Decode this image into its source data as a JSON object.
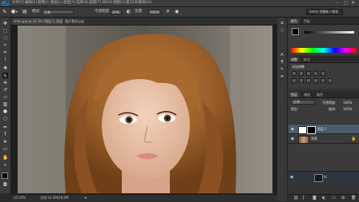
{
  "app": {
    "logo": "Ps"
  },
  "menu": [
    "文件(F)",
    "编辑(E)",
    "图像(I)",
    "图层(L)",
    "类型(Y)",
    "选择(S)",
    "滤镜(T)",
    "3D(D)",
    "视图(V)",
    "窗口(W)",
    "帮助(H)"
  ],
  "options_bar": {
    "mode_label": "模式:",
    "mode_value": "正常",
    "opacity_label": "不透明度:",
    "opacity_value": "20%",
    "flow_label": "流量:",
    "flow_value": "100%",
    "workspace": "Smile 涂磨新人教程"
  },
  "document": {
    "tab_title": "shou.jpg @ 33.3% (图层 1, 图层蒙版/8) *",
    "tab_title_2": "图片素材.jpg"
  },
  "status": {
    "zoom": "33.33%",
    "doc_size": "文档:14.3M/28.6M"
  },
  "panels": {
    "color_tabs": [
      "颜色",
      "色板"
    ],
    "adjust_tabs": [
      "调整",
      "样式"
    ],
    "adjust_title": "添加调整",
    "layers_tabs": [
      "图层",
      "通道",
      "路径"
    ],
    "blend_mode": "正常",
    "opacity_label": "不透明度:",
    "opacity_value": "100%",
    "fill_label": "填充:",
    "fill_value": "100%",
    "lock_label": "锁定:"
  },
  "layers": [
    {
      "name": "图层 1",
      "visible": true,
      "has_mask": true
    },
    {
      "name": "背景",
      "visible": true,
      "has_mask": false
    }
  ],
  "bottom_layer_label": "fx",
  "colors": {
    "accent": "#39a0ff",
    "selected_layer": "#4b5a6e"
  }
}
